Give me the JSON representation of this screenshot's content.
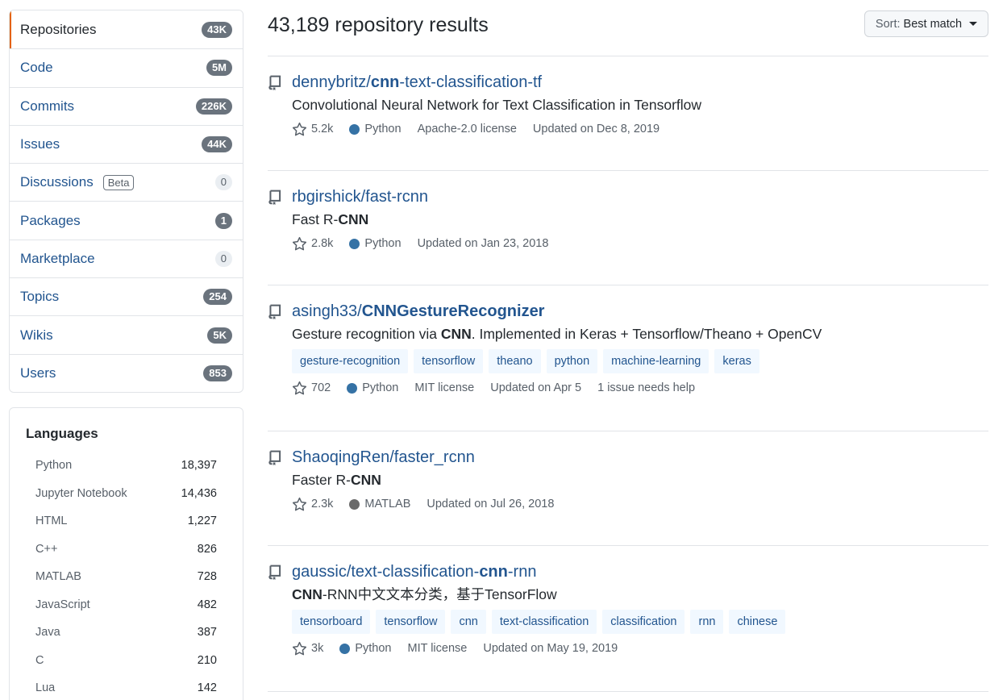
{
  "menu": [
    {
      "label": "Repositories",
      "count": "43K",
      "selected": true
    },
    {
      "label": "Code",
      "count": "5M"
    },
    {
      "label": "Commits",
      "count": "226K"
    },
    {
      "label": "Issues",
      "count": "44K"
    },
    {
      "label": "Discussions",
      "count": "0",
      "badge": "Beta",
      "light": true
    },
    {
      "label": "Packages",
      "count": "1"
    },
    {
      "label": "Marketplace",
      "count": "0",
      "light": true
    },
    {
      "label": "Topics",
      "count": "254"
    },
    {
      "label": "Wikis",
      "count": "5K"
    },
    {
      "label": "Users",
      "count": "853"
    }
  ],
  "languages": {
    "title": "Languages",
    "items": [
      {
        "name": "Python",
        "count": "18,397"
      },
      {
        "name": "Jupyter Notebook",
        "count": "14,436"
      },
      {
        "name": "HTML",
        "count": "1,227"
      },
      {
        "name": "C++",
        "count": "826"
      },
      {
        "name": "MATLAB",
        "count": "728"
      },
      {
        "name": "JavaScript",
        "count": "482"
      },
      {
        "name": "Java",
        "count": "387"
      },
      {
        "name": "C",
        "count": "210"
      },
      {
        "name": "Lua",
        "count": "142"
      }
    ]
  },
  "header": {
    "results": "43,189 repository results",
    "sort_prefix": "Sort:",
    "sort_value": "Best match"
  },
  "colors": {
    "python": "#3572A5",
    "matlab": "#6a6a6a",
    "link": "#22558f",
    "selected_marker": "#e36209"
  },
  "repos": [
    {
      "owner": "dennybritz/",
      "name_pre": "",
      "name_bold": "cnn",
      "name_post": "-text-classification-tf",
      "desc_pre": "",
      "desc_bold": "",
      "desc_post": "Convolutional Neural Network for Text Classification in Tensorflow",
      "topics": [],
      "stars": "5.2k",
      "language": "Python",
      "lang_color": "#3572A5",
      "license": "Apache-2.0 license",
      "updated": "Updated on Dec 8, 2019",
      "extra": ""
    },
    {
      "owner": "rbgirshick/",
      "name_pre": "fast-rcnn",
      "name_bold": "",
      "name_post": "",
      "desc_pre": "Fast R-",
      "desc_bold": "CNN",
      "desc_post": "",
      "topics": [],
      "stars": "2.8k",
      "language": "Python",
      "lang_color": "#3572A5",
      "license": "",
      "updated": "Updated on Jan 23, 2018",
      "extra": ""
    },
    {
      "owner": "asingh33/",
      "name_pre": "",
      "name_bold": "CNNGestureRecognizer",
      "name_post": "",
      "desc_pre": "Gesture recognition via ",
      "desc_bold": "CNN",
      "desc_post": ". Implemented in Keras + Tensorflow/Theano + OpenCV",
      "topics": [
        "gesture-recognition",
        "tensorflow",
        "theano",
        "python",
        "machine-learning",
        "keras"
      ],
      "stars": "702",
      "language": "Python",
      "lang_color": "#3572A5",
      "license": "MIT license",
      "updated": "Updated on Apr 5",
      "extra": "1 issue needs help"
    },
    {
      "owner": "ShaoqingRen/",
      "name_pre": "faster_rcnn",
      "name_bold": "",
      "name_post": "",
      "desc_pre": "Faster R-",
      "desc_bold": "CNN",
      "desc_post": "",
      "topics": [],
      "stars": "2.3k",
      "language": "MATLAB",
      "lang_color": "#6a6a6a",
      "license": "",
      "updated": "Updated on Jul 26, 2018",
      "extra": ""
    },
    {
      "owner": "gaussic/",
      "name_pre": "text-classification-",
      "name_bold": "cnn",
      "name_post": "-rnn",
      "desc_pre": "",
      "desc_bold": "CNN",
      "desc_post": "-RNN中文文本分类，基于TensorFlow",
      "topics": [
        "tensorboard",
        "tensorflow",
        "cnn",
        "text-classification",
        "classification",
        "rnn",
        "chinese"
      ],
      "stars": "3k",
      "language": "Python",
      "lang_color": "#3572A5",
      "license": "MIT license",
      "updated": "Updated on May 19, 2019",
      "extra": ""
    }
  ]
}
